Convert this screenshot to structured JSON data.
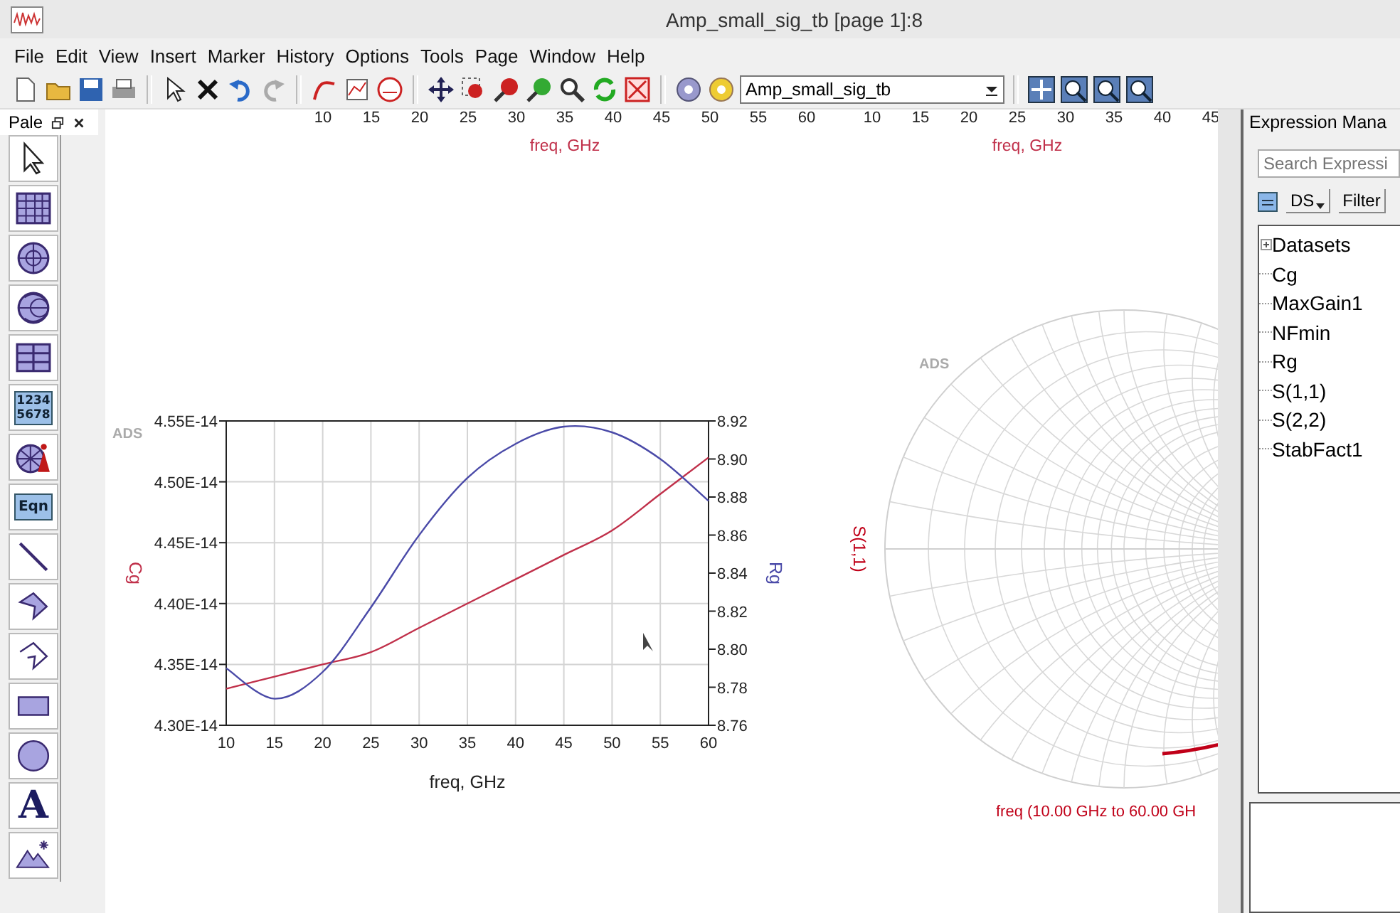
{
  "window": {
    "title": "Amp_small_sig_tb [page 1]:8"
  },
  "menu": [
    "File",
    "Edit",
    "View",
    "Insert",
    "Marker",
    "History",
    "Options",
    "Tools",
    "Page",
    "Window",
    "Help"
  ],
  "toolbar": {
    "design_dropdown": "Amp_small_sig_tb"
  },
  "palette": {
    "title": "Pale",
    "items": [
      {
        "kind": "pointer"
      },
      {
        "kind": "grid"
      },
      {
        "kind": "polar"
      },
      {
        "kind": "smith"
      },
      {
        "kind": "list"
      },
      {
        "kind": "numbers",
        "lines": [
          "1234",
          "5678"
        ]
      },
      {
        "kind": "smith-marker"
      },
      {
        "kind": "eqn",
        "label": "Eqn"
      },
      {
        "kind": "line"
      },
      {
        "kind": "polygon"
      },
      {
        "kind": "polyline"
      },
      {
        "kind": "rectangle"
      },
      {
        "kind": "ellipse"
      },
      {
        "kind": "text",
        "label": "A"
      },
      {
        "kind": "image"
      }
    ]
  },
  "top_axes": [
    {
      "ticks": [
        "10",
        "15",
        "20",
        "25",
        "30",
        "35",
        "40",
        "45",
        "50",
        "55",
        "60"
      ],
      "xlabel": "freq, GHz"
    },
    {
      "ticks": [
        "10",
        "15",
        "20",
        "25",
        "30",
        "35",
        "40",
        "45"
      ],
      "xlabel": "freq, GHz"
    }
  ],
  "plot": {
    "watermark": "ADS",
    "chart_data": {
      "type": "line",
      "xlabel": "freq, GHz",
      "grid": true,
      "x": [
        10,
        15,
        20,
        25,
        30,
        35,
        40,
        45,
        50,
        55,
        60
      ],
      "series": [
        {
          "name": "Cg",
          "color": "#c0304a",
          "values": [
            4.33e-14,
            4.34e-14,
            4.35e-14,
            4.36e-14,
            4.38e-14,
            4.4e-14,
            4.42e-14,
            4.44e-14,
            4.46e-14,
            4.49e-14,
            4.52e-14
          ]
        },
        {
          "name": "Rg",
          "color": "#4a4aa8",
          "axis": "y2",
          "values": [
            8.79,
            8.774,
            8.788,
            8.822,
            8.86,
            8.89,
            8.908,
            8.917,
            8.914,
            8.9,
            8.878
          ]
        }
      ],
      "xlim": [
        10,
        60
      ],
      "ylim": [
        4.3e-14,
        4.55e-14
      ],
      "y2lim": [
        8.76,
        8.92
      ],
      "xticks": [
        10,
        15,
        20,
        25,
        30,
        35,
        40,
        45,
        50,
        55,
        60
      ],
      "yticks": [
        {
          "value": 4.3e-14,
          "label": "4.30E-14"
        },
        {
          "value": 4.35e-14,
          "label": "4.35E-14"
        },
        {
          "value": 4.4e-14,
          "label": "4.40E-14"
        },
        {
          "value": 4.45e-14,
          "label": "4.45E-14"
        },
        {
          "value": 4.5e-14,
          "label": "4.50E-14"
        },
        {
          "value": 4.55e-14,
          "label": "4.55E-14"
        }
      ],
      "y2ticks": [
        {
          "value": 8.76,
          "label": "8.76"
        },
        {
          "value": 8.78,
          "label": "8.78"
        },
        {
          "value": 8.8,
          "label": "8.80"
        },
        {
          "value": 8.82,
          "label": "8.82"
        },
        {
          "value": 8.84,
          "label": "8.84"
        },
        {
          "value": 8.86,
          "label": "8.86"
        },
        {
          "value": 8.88,
          "label": "8.88"
        },
        {
          "value": 8.9,
          "label": "8.90"
        },
        {
          "value": 8.92,
          "label": "8.92"
        }
      ]
    }
  },
  "smith": {
    "watermark": "ADS",
    "ylabel": "S(1,1)",
    "caption": "freq (10.00 GHz to 60.00 GH"
  },
  "expression_manager": {
    "title": "Expression Mana",
    "search": {
      "placeholder": "Search Expressi"
    },
    "ds_button": "DS",
    "filter_button": "Filter",
    "items": [
      {
        "kind": "group",
        "label": "Datasets"
      },
      {
        "kind": "expression",
        "label": "Cg"
      },
      {
        "kind": "expression",
        "label": "MaxGain1"
      },
      {
        "kind": "expression",
        "label": "NFmin"
      },
      {
        "kind": "expression",
        "label": "Rg"
      },
      {
        "kind": "expression",
        "label": "S(1,1)"
      },
      {
        "kind": "expression",
        "label": "S(2,2)"
      },
      {
        "kind": "expression",
        "label": "StabFact1"
      }
    ]
  }
}
